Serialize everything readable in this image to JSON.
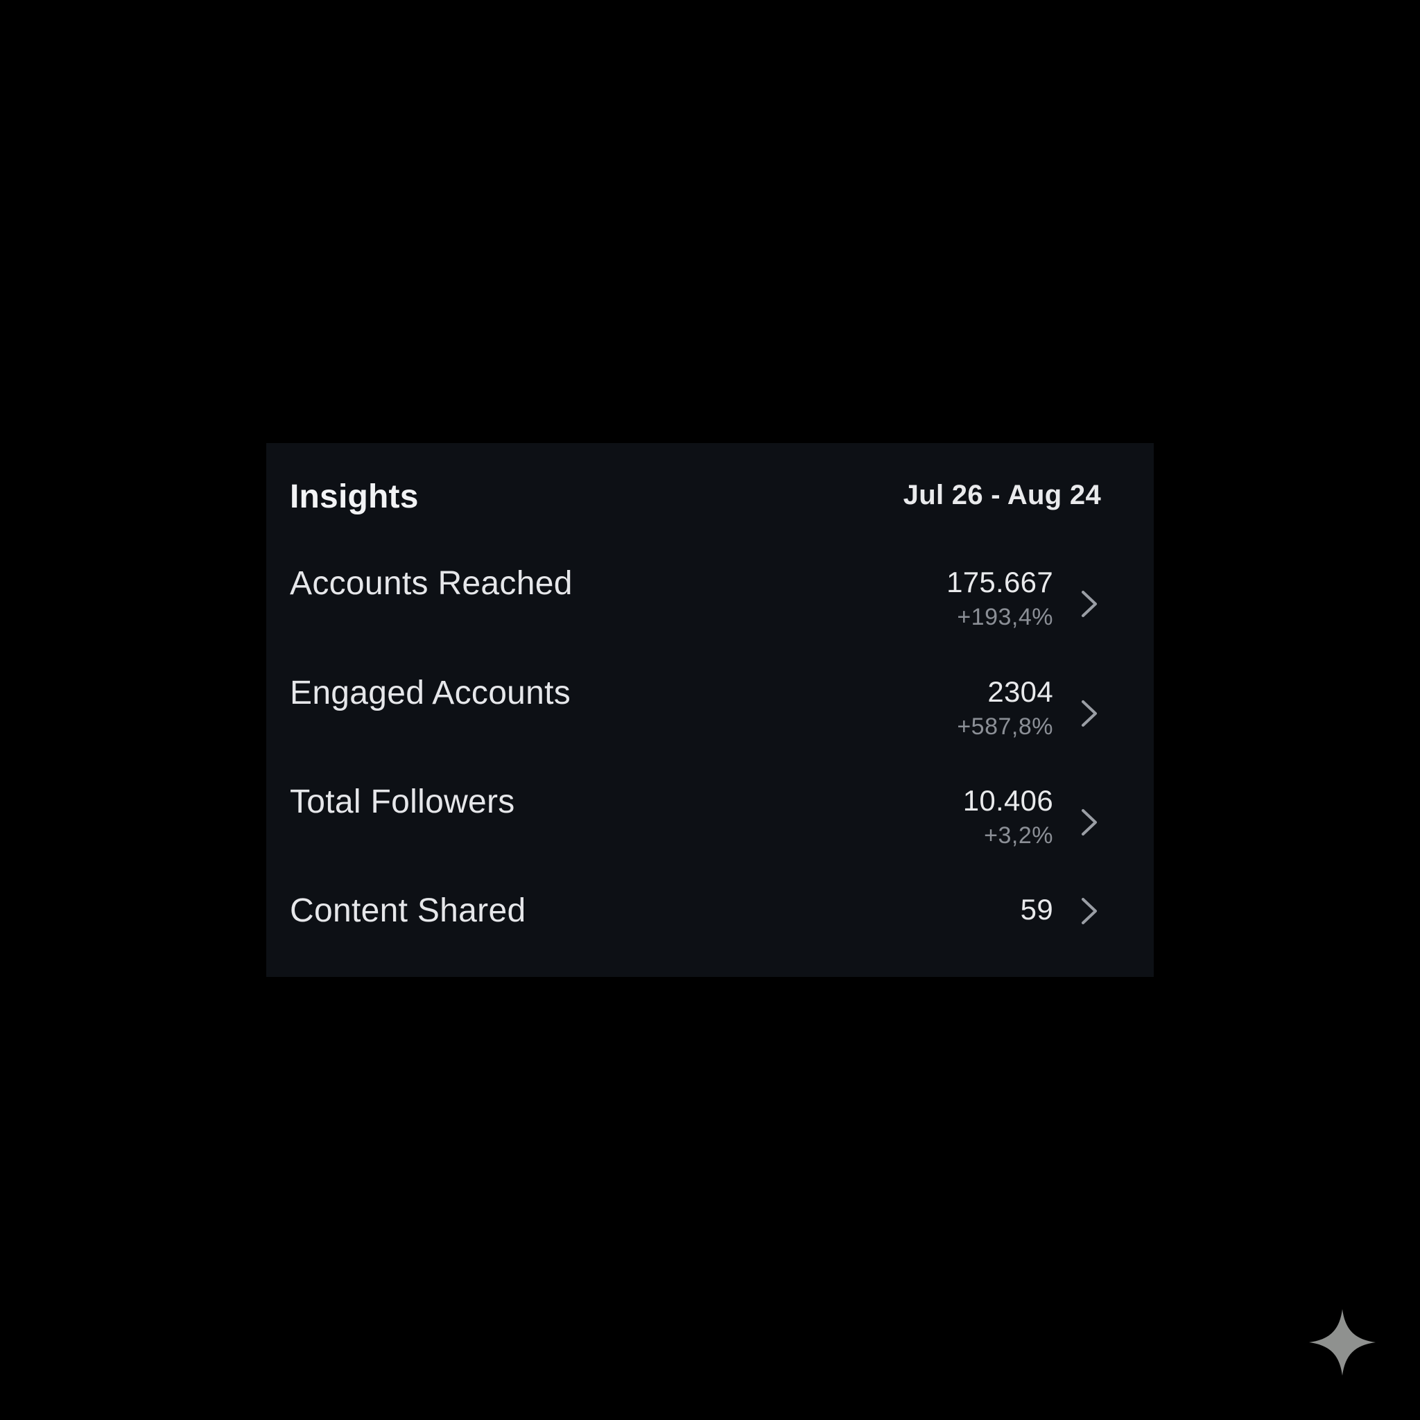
{
  "insights": {
    "title": "Insights",
    "date_range": "Jul 26 - Aug 24",
    "metrics": [
      {
        "label": "Accounts Reached",
        "value": "175.667",
        "change": "+193,4%"
      },
      {
        "label": "Engaged Accounts",
        "value": "2304",
        "change": "+587,8%"
      },
      {
        "label": "Total Followers",
        "value": "10.406",
        "change": "+3,2%"
      },
      {
        "label": "Content Shared",
        "value": "59"
      }
    ]
  },
  "icons": {
    "row_chevron": "chevron-right-icon",
    "corner_mark": "sparkle-icon"
  },
  "colors": {
    "page_background": "#000000",
    "card_background": "#0d1015",
    "primary_text": "#e9eaec",
    "secondary_text": "#8b8f96",
    "chevron": "#9a9ea5",
    "sparkle": "#8f918f"
  }
}
